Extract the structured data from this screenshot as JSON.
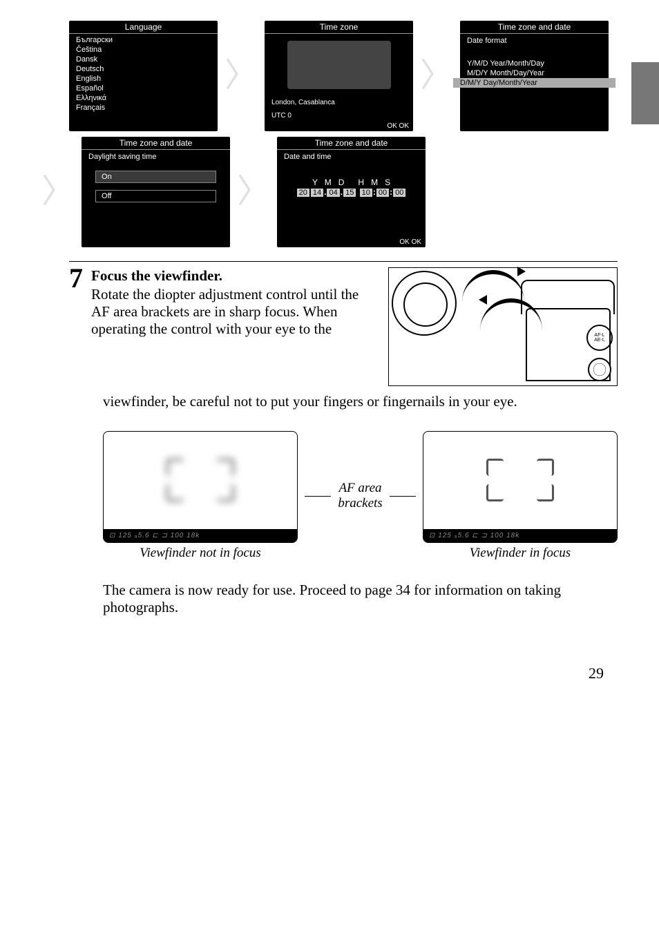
{
  "screens": {
    "language": {
      "title": "Language",
      "items": [
        "Български",
        "Čeština",
        "Dansk",
        "Deutsch",
        "English",
        "Español",
        "Ελληνικά",
        "Français"
      ]
    },
    "timezone": {
      "title": "Time zone",
      "location": "London, Casablanca",
      "utc": "UTC  0",
      "ok": "OK OK"
    },
    "dateformat": {
      "title": "Time zone and date",
      "subtitle": "Date format",
      "options": [
        "Y/M/D Year/Month/Day",
        "M/D/Y Month/Day/Year",
        "D/M/Y Day/Month/Year"
      ]
    },
    "dst": {
      "title": "Time zone and date",
      "subtitle": "Daylight saving time",
      "on": "On",
      "off": "Off"
    },
    "datetime": {
      "title": "Time zone and date",
      "subtitle": "Date and time",
      "headers": "Y   M   D      H   M   S",
      "values": [
        "20",
        "14",
        ".",
        "04",
        ".",
        "15",
        " ",
        "10",
        ":",
        "00",
        ":",
        "00"
      ],
      "ok": "OK OK"
    }
  },
  "step": {
    "number": "7",
    "title": "Focus the viewfinder.",
    "body": "Rotate the diopter adjustment control until the AF area brackets are in sharp focus. When operating the control with your eye to the",
    "continuation": "viewfinder, be careful not to put your fingers or fingernails in your eye."
  },
  "knob_label": "AF-L\nAE-L",
  "viewfinder": {
    "mid_label": "AF area brackets",
    "info": "⊡  125  ₅5.6         ⊏  ⊐  100  18k",
    "not_focus": "Viewfinder not in focus",
    "in_focus": "Viewfinder in focus"
  },
  "final_text": "The camera is now ready for use.  Proceed to page 34 for information on taking photographs.",
  "page_number": "29"
}
